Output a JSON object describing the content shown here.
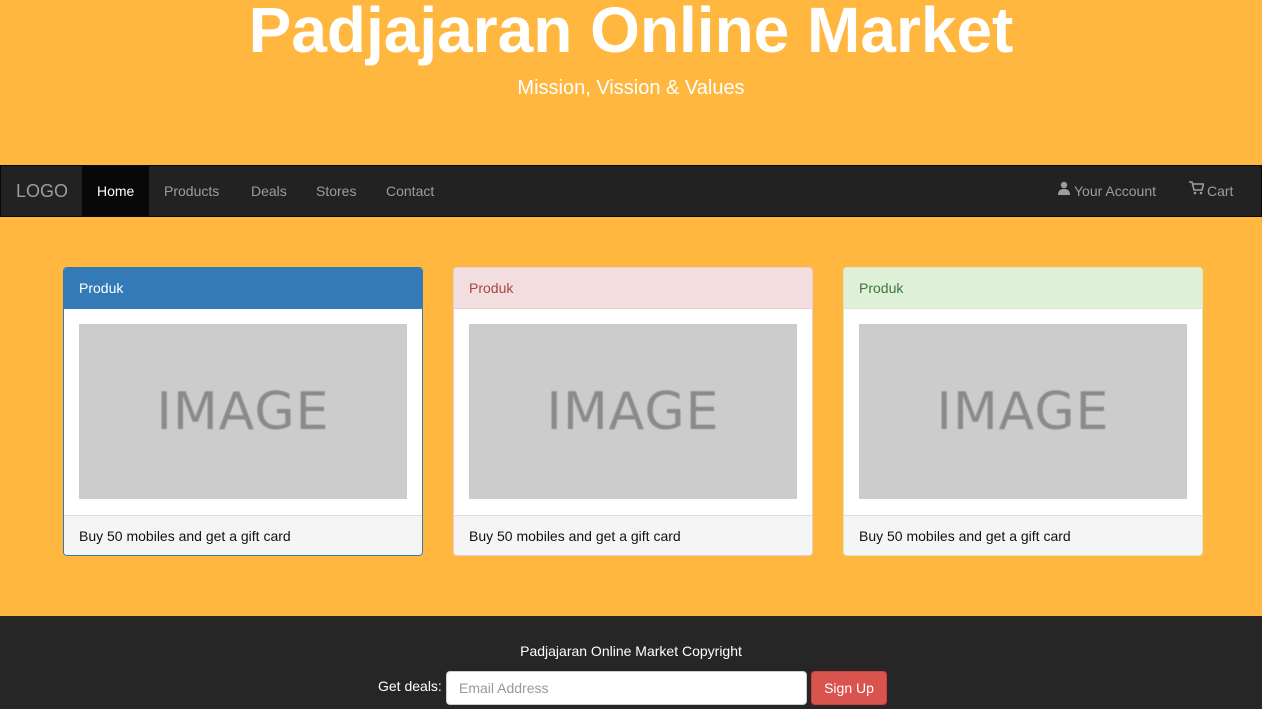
{
  "header": {
    "title": "Padjajaran Online Market",
    "subtitle": "Mission, Vission & Values"
  },
  "navbar": {
    "brand": "LOGO",
    "items": [
      {
        "label": "Home",
        "active": true
      },
      {
        "label": "Products"
      },
      {
        "label": "Deals"
      },
      {
        "label": "Stores"
      },
      {
        "label": "Contact"
      }
    ],
    "right": {
      "account": {
        "label": "Your Account",
        "icon": "user-icon"
      },
      "cart": {
        "label": "Cart",
        "icon": "cart-icon"
      }
    }
  },
  "panels": [
    {
      "heading": "Produk",
      "style": "primary",
      "image_text": "IMAGE",
      "footer": "Buy 50 mobiles and get a gift card"
    },
    {
      "heading": "Produk",
      "style": "danger",
      "image_text": "IMAGE",
      "footer": "Buy 50 mobiles and get a gift card"
    },
    {
      "heading": "Produk",
      "style": "success",
      "image_text": "IMAGE",
      "footer": "Buy 50 mobiles and get a gift card"
    }
  ],
  "footer": {
    "copyright": "Padjajaran Online Market Copyright",
    "deals_label": "Get deals:",
    "email_placeholder": "Email Address",
    "signup_label": "Sign Up"
  },
  "colors": {
    "background": "#ffb740",
    "navbar": "#222222",
    "footer": "#262626",
    "primary": "#337ab7",
    "danger": "#d9534f"
  }
}
